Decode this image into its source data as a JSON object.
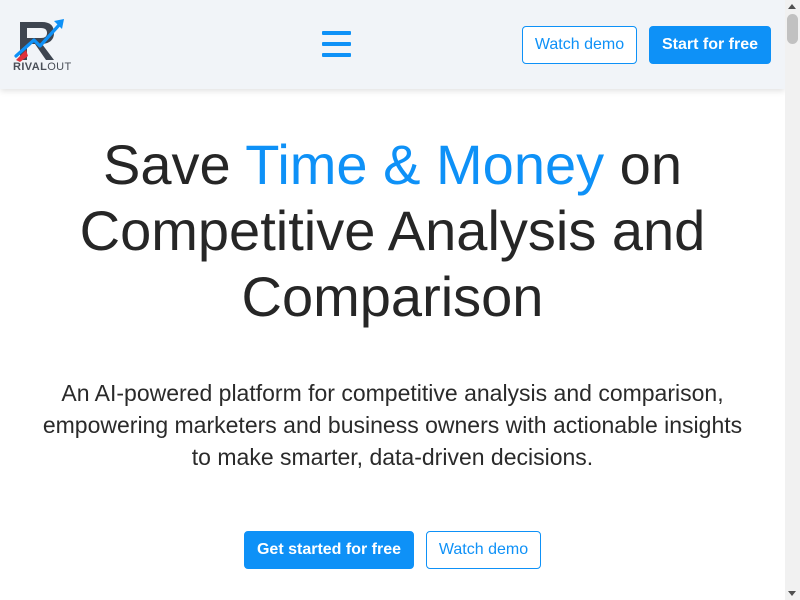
{
  "brand": {
    "name_bold": "RIVAL",
    "name_light": "OUT"
  },
  "header": {
    "watch_demo_label": "Watch demo",
    "start_free_label": "Start for free"
  },
  "hero": {
    "title_part1": "Save ",
    "title_accent": "Time & Money",
    "title_part2": " on Competitive Analysis and Comparison",
    "subtitle": "An AI-powered platform for competitive analysis and comparison, empowering marketers and business owners with actionable insights to make smarter, data-driven decisions.",
    "cta_primary": "Get started for free",
    "cta_secondary": "Watch demo"
  },
  "colors": {
    "accent": "#0e91f7",
    "header_bg": "#f1f4f8",
    "text": "#262626",
    "logo_red": "#e0303a",
    "logo_gray": "#3e4550"
  },
  "icons": [
    "rivalout-logo-icon",
    "hamburger-menu-icon"
  ]
}
